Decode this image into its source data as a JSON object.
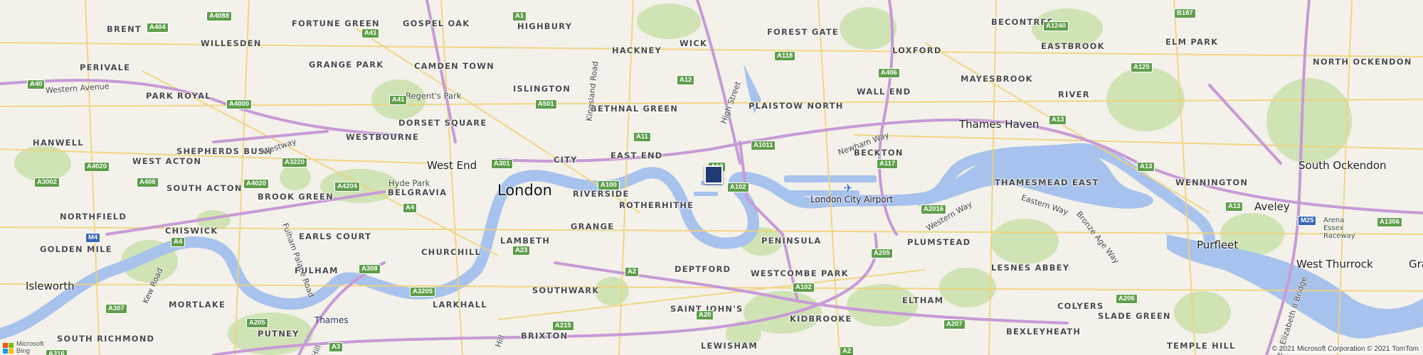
{
  "map": {
    "colors": {
      "land": "#f3f1ea",
      "water": "#a7c2ec",
      "park": "#cfe3b5",
      "major_road": "#c79ad6",
      "minor_road": "#f1d37a",
      "marker": "#1f3b73",
      "shield_green": "#5e9e4a",
      "shield_blue": "#3865b5"
    },
    "city_label": "London",
    "towns": {
      "isleworth": "Isleworth",
      "west_end": "West End",
      "thames_haven": "Thames Haven",
      "south_ockendon": "South Ockendon",
      "aveley": "Aveley",
      "purfleet": "Purfleet",
      "west_thurrock": "West Thurrock",
      "grays": "Gra"
    },
    "districts": {
      "brent": "BRENT",
      "fortune_green": "FORTUNE GREEN",
      "gospel_oak": "GOSPEL OAK",
      "highbury": "HIGHBURY",
      "wick": "WICK",
      "forest_gate": "FOREST GATE",
      "becontree": "BECONTREE",
      "willesden": "WILLESDEN",
      "hackney": "HACKNEY",
      "loxford": "LOXFORD",
      "eastbrook": "EASTBROOK",
      "elm_park": "ELM PARK",
      "perivale": "PERIVALE",
      "grange_park": "GRANGE PARK",
      "camden_town": "CAMDEN TOWN",
      "mayesbrook": "MAYESBROOK",
      "north_ockendon": "NORTH OCKENDON",
      "park_royal": "PARK ROYAL",
      "islington": "ISLINGTON",
      "bethnal_green": "BETHNAL GREEN",
      "plaistow_north": "PLAISTOW NORTH",
      "wall_end": "WALL END",
      "river": "RIVER",
      "hanwell": "HANWELL",
      "shepherds_bush": "SHEPHERDS BUSH",
      "dorset_square": "DORSET SQUARE",
      "westbourne": "WESTBOURNE",
      "east_end": "EAST END",
      "city": "CITY",
      "beckton": "BECKTON",
      "west_acton": "WEST ACTON",
      "wennington": "WENNINGTON",
      "south_acton": "SOUTH ACTON",
      "brook_green": "BROOK GREEN",
      "belgravia": "BELGRAVIA",
      "riverside": "RIVERSIDE",
      "thamesmead_east": "THAMESMEAD EAST",
      "northfield": "NORTHFIELD",
      "rotherhithe": "ROTHERHITHE",
      "grange": "GRANGE",
      "chiswick": "CHISWICK",
      "earls_court": "EARLS COURT",
      "lambeth": "LAMBETH",
      "peninsula": "PENINSULA",
      "golden_mile": "GOLDEN MILE",
      "churchill": "CHURCHILL",
      "plumstead": "PLUMSTEAD",
      "fulham": "FULHAM",
      "deptford": "DEPTFORD",
      "westcombe_park": "WESTCOMBE PARK",
      "lesnes_abbey": "LESNES ABBEY",
      "southwark": "SOUTHWARK",
      "mortlake": "MORTLAKE",
      "larkhall": "LARKHALL",
      "eltham": "ELTHAM",
      "colyers": "COLYERS",
      "saint_johns": "SAINT JOHN'S",
      "slade_green": "SLADE GREEN",
      "south_richmond": "SOUTH RICHMOND",
      "putney": "PUTNEY",
      "brixton": "BRIXTON",
      "kidbrooke": "KIDBROOKE",
      "bexleyheath": "BEXLEYHEATH",
      "lewisham": "LEWISHAM",
      "temple_hill": "TEMPLE HILL"
    },
    "parks": {
      "regents_park": "Regent's Park",
      "hyde_park": "Hyde Park",
      "arena_essex": "Arena Essex Raceway"
    },
    "road_names": {
      "western_avenue": "Western Avenue",
      "westway": "Westway",
      "kingsland_road": "Kingsland Road",
      "high_street": "High Street",
      "newham_way": "Newham Way",
      "western_way": "Western Way",
      "eastern_way": "Eastern Way",
      "bronze_age_way": "Bronze Age Way",
      "fulham_palace_road": "Fulham Palace Road",
      "kew_road": "Kew Road",
      "queen_elizabeth_bridge": "Queen Elizabeth II Bridge",
      "hill": "Hill",
      "hill2": "Hill"
    },
    "water_labels": {
      "thames": "Thames"
    },
    "airport_label": "London City Airport",
    "shields": {
      "a4088": "A4088",
      "a404": "A404",
      "a41": "A41",
      "a1": "A1",
      "a12": "A12",
      "a118": "A118",
      "a1240": "A1240",
      "b187": "B187",
      "a40": "A40",
      "a406": "A406",
      "a125": "A125",
      "a501": "A501",
      "a41b": "A41",
      "a4000": "A4000",
      "a13": "A13",
      "a11": "A11",
      "a1011": "A1011",
      "a117": "A117",
      "a4020": "A4020",
      "a3220": "A3220",
      "a301": "A301",
      "a13b": "A13",
      "a3002": "A3002",
      "a4020b": "A4020",
      "a4204": "A4204",
      "a100": "A100",
      "a102": "A102",
      "a13c": "A13",
      "a406b": "A406",
      "a4": "A4",
      "a2016": "A2016",
      "m4": "M4",
      "a4b": "A4",
      "a23": "A23",
      "a205": "A205",
      "a13d": "A13",
      "a308": "A308",
      "a2": "A2",
      "m25": "M25",
      "a1306": "A1306",
      "a307": "A307",
      "a3205": "A3205",
      "a102b": "A102",
      "a206": "A206",
      "a205b": "A205",
      "a3": "A3",
      "a20": "A20",
      "a215": "A215",
      "a207": "A207",
      "a2b": "A2",
      "a316": "A316"
    },
    "marker_name": "location-pin",
    "attribution": {
      "logo_line1": "Microsoft",
      "logo_line2": "Bing",
      "copyright": "© 2021 Microsoft Corporation © 2021 TomTom"
    }
  }
}
